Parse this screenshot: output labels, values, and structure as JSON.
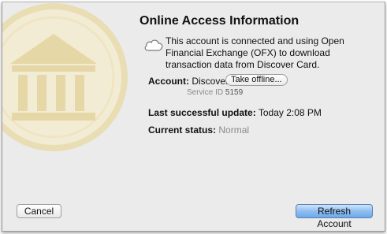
{
  "dialog": {
    "title": "Online Access Information",
    "description": "This account is connected and using Open Financial Exchange (OFX) to download transaction data from Discover Card."
  },
  "account": {
    "label": "Account:",
    "value": "Discover",
    "offline_button": "Take offline...",
    "service_id_label": "Service ID",
    "service_id_value": "5159"
  },
  "last_update": {
    "label": "Last successful update:",
    "value": "Today 2:08 PM"
  },
  "status": {
    "label": "Current status:",
    "value": "Normal"
  },
  "buttons": {
    "cancel": "Cancel",
    "refresh": "Refresh Account"
  },
  "icons": {
    "watermark": "bank-icon",
    "cloud": "cloud-icon"
  },
  "colors": {
    "watermark": "#e6d7a6",
    "default_button": "#8fbef0"
  }
}
